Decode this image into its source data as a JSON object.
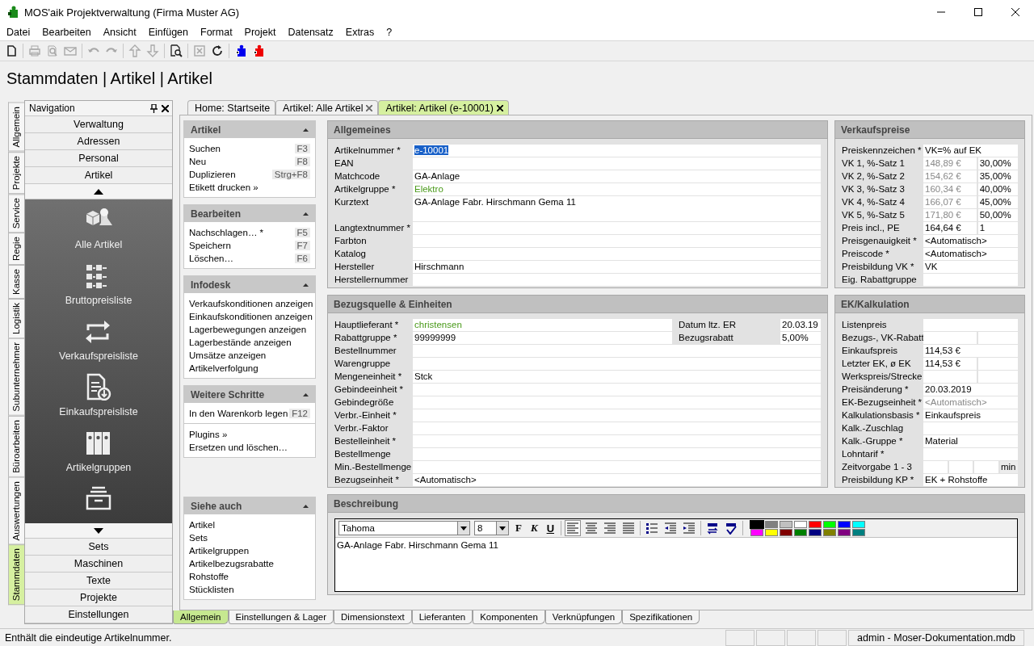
{
  "window": {
    "title": "MOS'aik Projektverwaltung (Firma Muster AG)"
  },
  "menu": [
    "Datei",
    "Bearbeiten",
    "Ansicht",
    "Einfügen",
    "Format",
    "Projekt",
    "Datensatz",
    "Extras",
    "?"
  ],
  "toolbar": [
    {
      "kind": "new",
      "disabled": false
    },
    {
      "kind": "sep"
    },
    {
      "kind": "print",
      "disabled": true
    },
    {
      "kind": "preview",
      "disabled": true
    },
    {
      "kind": "mail",
      "disabled": true
    },
    {
      "kind": "sep"
    },
    {
      "kind": "undo",
      "disabled": true
    },
    {
      "kind": "redo",
      "disabled": true
    },
    {
      "kind": "sep"
    },
    {
      "kind": "up",
      "disabled": true
    },
    {
      "kind": "down",
      "disabled": true
    },
    {
      "kind": "sep"
    },
    {
      "kind": "find",
      "disabled": false
    },
    {
      "kind": "sep"
    },
    {
      "kind": "sheet",
      "disabled": true
    },
    {
      "kind": "refresh",
      "disabled": false
    },
    {
      "kind": "sep"
    },
    {
      "kind": "puzzle",
      "disabled": false,
      "color": "#0000ee"
    },
    {
      "kind": "puzzle",
      "disabled": false,
      "color": "#ee0000"
    }
  ],
  "heading": "Stammdaten | Artikel | Artikel",
  "side_tabs": [
    {
      "label": "Allgemein",
      "selected": false
    },
    {
      "label": "Projekte",
      "selected": false
    },
    {
      "label": "Service",
      "selected": false
    },
    {
      "label": "Regie",
      "selected": false
    },
    {
      "label": "Kasse",
      "selected": false
    },
    {
      "label": "Logistik",
      "selected": false
    },
    {
      "label": "Subunternehmer",
      "selected": false
    },
    {
      "label": "Büroarbeiten",
      "selected": false
    },
    {
      "label": "Auswertungen",
      "selected": false
    },
    {
      "label": "Stammdaten",
      "selected": true
    }
  ],
  "navigation": {
    "title": "Navigation",
    "top_groups": [
      "Verwaltung",
      "Adressen",
      "Personal",
      "Artikel"
    ],
    "items": [
      {
        "kind": "cubes",
        "label": "Alle Artikel"
      },
      {
        "kind": "grid",
        "label": "Bruttopreisliste"
      },
      {
        "kind": "swap",
        "label": "Verkaufspreisliste"
      },
      {
        "kind": "doc",
        "label": "Einkaufspreisliste"
      },
      {
        "kind": "binders",
        "label": "Artikelgruppen"
      },
      {
        "kind": "tray"
      }
    ],
    "bottom_groups": [
      "Sets",
      "Maschinen",
      "Texte",
      "Projekte",
      "Einstellungen"
    ]
  },
  "tabs": [
    {
      "label": "Home: Startseite",
      "closable": false,
      "selected": false
    },
    {
      "label": "Artikel: Alle Artikel",
      "closable": true,
      "selected": false
    },
    {
      "label": "Artikel: Artikel (e-10001)",
      "closable": true,
      "selected": true
    }
  ],
  "tasks": [
    {
      "title": "Artikel",
      "groups": [
        [
          {
            "label": "Suchen",
            "key": "F3"
          },
          {
            "label": "Neu",
            "key": "F8"
          },
          {
            "label": "Duplizieren",
            "key": "Strg+F8"
          },
          {
            "label": "Etikett drucken »"
          }
        ]
      ]
    },
    {
      "title": "Bearbeiten",
      "groups": [
        [
          {
            "label": "Nachschlagen… *",
            "key": "F5"
          },
          {
            "label": "Speichern",
            "key": "F7"
          },
          {
            "label": "Löschen…",
            "key": "F6"
          }
        ]
      ]
    },
    {
      "title": "Infodesk",
      "groups": [
        [
          {
            "label": "Verkaufskonditionen anzeigen"
          },
          {
            "label": "Einkaufskonditionen anzeigen"
          },
          {
            "label": "Lagerbewegungen anzeigen"
          },
          {
            "label": "Lagerbestände anzeigen"
          },
          {
            "label": "Umsätze anzeigen"
          },
          {
            "label": "Artikelverfolgung"
          }
        ]
      ]
    },
    {
      "title": "Weitere Schritte",
      "groups": [
        [
          {
            "label": "In den Warenkorb legen",
            "key": "F12"
          }
        ],
        [
          {
            "label": "Plugins »"
          },
          {
            "label": "Ersetzen und löschen…"
          }
        ]
      ]
    }
  ],
  "see_also": {
    "title": "Siehe auch",
    "items": [
      "Artikel",
      "Sets",
      "Artikelgruppen",
      "Artikelbezugsrabatte",
      "Rohstoffe",
      "Stücklisten"
    ]
  },
  "sections": [
    {
      "title": "Allgemeines",
      "fields": [
        {
          "label": "Artikelnummer *",
          "cells": [
            {
              "text": "e-10001",
              "selected": true
            }
          ]
        },
        {
          "label": "EAN",
          "cells": [
            {}
          ]
        },
        {
          "label": "Matchcode",
          "cells": [
            {
              "text": "GA-Anlage"
            }
          ]
        },
        {
          "label": "Artikelgruppe *",
          "cells": [
            {
              "text": "Elektro",
              "kind": "link"
            }
          ]
        },
        {
          "label": "Kurztext",
          "multiline": true,
          "cells": [
            {
              "text": "GA-Anlage Fabr. Hirschmann Gema 11"
            }
          ]
        },
        {
          "label": "Langtextnummer *",
          "cells": [
            {}
          ]
        },
        {
          "label": "Farbton",
          "cells": [
            {}
          ]
        },
        {
          "label": "Katalog",
          "cells": [
            {}
          ]
        },
        {
          "label": "Hersteller",
          "cells": [
            {
              "text": "Hirschmann"
            }
          ]
        },
        {
          "label": "Herstellernummer",
          "cells": [
            {}
          ]
        }
      ]
    },
    {
      "title": "Verkaufspreise",
      "fields": [
        {
          "label": "Preiskennzeichen *",
          "cells": [
            {
              "text": "VK=% auf EK"
            }
          ]
        },
        {
          "label": "VK 1, %-Satz 1",
          "cells": [
            {
              "text": "148,89 €",
              "kind": "muted"
            },
            {
              "text": "30,00%"
            }
          ]
        },
        {
          "label": "VK 2, %-Satz 2",
          "cells": [
            {
              "text": "154,62 €",
              "kind": "muted"
            },
            {
              "text": "35,00%"
            }
          ]
        },
        {
          "label": "VK 3, %-Satz 3",
          "cells": [
            {
              "text": "160,34 €",
              "kind": "muted"
            },
            {
              "text": "40,00%"
            }
          ]
        },
        {
          "label": "VK 4, %-Satz 4",
          "cells": [
            {
              "text": "166,07 €",
              "kind": "muted"
            },
            {
              "text": "45,00%"
            }
          ]
        },
        {
          "label": "VK 5, %-Satz 5",
          "cells": [
            {
              "text": "171,80 €",
              "kind": "muted"
            },
            {
              "text": "50,00%"
            }
          ]
        },
        {
          "label": "Preis incl., PE",
          "cells": [
            {
              "text": "164,64 €"
            },
            {
              "text": "1"
            }
          ]
        },
        {
          "label": "Preisgenauigkeit *",
          "cells": [
            {
              "text": "<Automatisch>"
            }
          ]
        },
        {
          "label": "Preiscode *",
          "cells": [
            {
              "text": "<Automatisch>"
            }
          ]
        },
        {
          "label": "Preisbildung VK *",
          "cells": [
            {
              "text": "VK"
            }
          ]
        },
        {
          "label": "Eig. Rabattgruppe",
          "cells": [
            {}
          ]
        }
      ]
    },
    {
      "title": "Bezugsquelle & Einheiten",
      "fields": [
        {
          "label": "Hauptlieferant *",
          "cells": [
            {
              "text": "christensen",
              "kind": "link"
            },
            {
              "text": "Datum ltz. ER",
              "kind": "label"
            },
            {
              "text": "20.03.19"
            }
          ]
        },
        {
          "label": "Rabattgruppe *",
          "cells": [
            {
              "text": "99999999"
            },
            {
              "text": "Bezugsrabatt",
              "kind": "label"
            },
            {
              "text": "5,00%"
            }
          ]
        },
        {
          "label": "Bestellnummer",
          "cells": [
            {}
          ]
        },
        {
          "label": "Warengruppe",
          "cells": [
            {}
          ]
        },
        {
          "label": "Mengeneinheit *",
          "cells": [
            {
              "text": "Stck"
            }
          ]
        },
        {
          "label": "Gebindeeinheit *",
          "cells": [
            {}
          ]
        },
        {
          "label": "Gebindegröße",
          "cells": [
            {}
          ]
        },
        {
          "label": "Verbr.-Einheit *",
          "cells": [
            {}
          ]
        },
        {
          "label": "Verbr.-Faktor",
          "cells": [
            {}
          ]
        },
        {
          "label": "Bestelleinheit *",
          "cells": [
            {}
          ]
        },
        {
          "label": "Bestellmenge",
          "cells": [
            {}
          ]
        },
        {
          "label": "Min.-Bestellmenge",
          "cells": [
            {}
          ]
        },
        {
          "label": "Bezugseinheit *",
          "cells": [
            {
              "text": "<Automatisch>"
            }
          ]
        }
      ]
    },
    {
      "title": "EK/Kalkulation",
      "fields": [
        {
          "label": "Listenpreis",
          "cells": [
            {}
          ]
        },
        {
          "label": "Bezugs-, VK-Rabatt",
          "cells": [
            {},
            {}
          ]
        },
        {
          "label": "Einkaufspreis",
          "cells": [
            {
              "text": "114,53 €"
            }
          ]
        },
        {
          "label": "Letzter EK, ø EK",
          "cells": [
            {
              "text": "114,53 €"
            },
            {}
          ]
        },
        {
          "label": "Werkspreis/Strecke",
          "cells": [
            {},
            {}
          ]
        },
        {
          "label": "Preisänderung *",
          "cells": [
            {
              "text": "20.03.2019"
            }
          ]
        },
        {
          "label": "EK-Bezugseinheit *",
          "cells": [
            {
              "text": "<Automatisch>",
              "kind": "muted"
            }
          ]
        },
        {
          "label": "Kalkulationsbasis *",
          "cells": [
            {
              "text": "Einkaufspreis"
            }
          ]
        },
        {
          "label": "Kalk.-Zuschlag",
          "cells": [
            {}
          ]
        },
        {
          "label": "Kalk.-Gruppe *",
          "cells": [
            {
              "text": "Material"
            }
          ]
        },
        {
          "label": "Lohntarif *",
          "cells": [
            {}
          ]
        },
        {
          "label": "Zeitvorgabe 1 - 3",
          "cells": [
            {},
            {},
            {},
            {
              "text": "min",
              "kind": "label"
            }
          ]
        },
        {
          "label": "Preisbildung KP *",
          "cells": [
            {
              "text": "EK + Rohstoffe"
            }
          ]
        }
      ]
    }
  ],
  "description": {
    "title": "Beschreibung",
    "font": "Tahoma",
    "size": "8",
    "format_buttons": [
      "F",
      "K",
      "U"
    ],
    "tools": [
      {
        "kind": "align-left",
        "selected": true
      },
      {
        "kind": "align-center",
        "selected": false
      },
      {
        "kind": "align-right",
        "selected": false
      },
      {
        "kind": "justify",
        "selected": false
      },
      {
        "kind": "sep"
      },
      {
        "kind": "bullets",
        "selected": false
      },
      {
        "kind": "outdent",
        "selected": false
      },
      {
        "kind": "indent",
        "selected": false
      },
      {
        "kind": "sep"
      },
      {
        "kind": "convert",
        "selected": false
      },
      {
        "kind": "spell",
        "selected": false
      },
      {
        "kind": "sep"
      }
    ],
    "palette": [
      {
        "color": "#000000",
        "selected": true
      },
      {
        "color": "#808080",
        "selected": false
      },
      {
        "color": "#c0c0c0",
        "selected": false
      },
      {
        "color": "#ffffff",
        "selected": false
      },
      {
        "color": "#ff0000",
        "selected": false
      },
      {
        "color": "#00ff00",
        "selected": false
      },
      {
        "color": "#0000ff",
        "selected": false
      },
      {
        "color": "#00ffff",
        "selected": false
      },
      {
        "color": "#ff00ff",
        "selected": false
      },
      {
        "color": "#ffff00",
        "selected": false
      },
      {
        "color": "#800000",
        "selected": false
      },
      {
        "color": "#008000",
        "selected": false
      },
      {
        "color": "#000080",
        "selected": false
      },
      {
        "color": "#808000",
        "selected": false
      },
      {
        "color": "#800080",
        "selected": false
      },
      {
        "color": "#008080",
        "selected": false
      }
    ],
    "text": "GA-Anlage Fabr. Hirschmann Gema 11"
  },
  "bottom_tabs": [
    {
      "label": "Allgemein",
      "selected": true
    },
    {
      "label": "Einstellungen & Lager",
      "selected": false
    },
    {
      "label": "Dimensionstext",
      "selected": false
    },
    {
      "label": "Lieferanten",
      "selected": false
    },
    {
      "label": "Komponenten",
      "selected": false
    },
    {
      "label": "Verknüpfungen",
      "selected": false
    },
    {
      "label": "Spezifikationen",
      "selected": false
    }
  ],
  "status_bar": {
    "message": "Enthält die eindeutige Artikelnummer.",
    "panes": [
      "admin - Moser-Dokumentation.mdb"
    ]
  }
}
